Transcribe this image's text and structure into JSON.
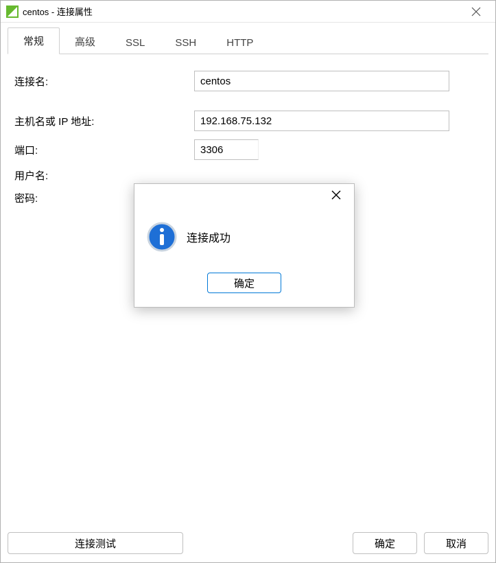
{
  "titlebar": {
    "title": "centos - 连接属性"
  },
  "tabs": {
    "general": "常规",
    "advanced": "高级",
    "ssl": "SSL",
    "ssh": "SSH",
    "http": "HTTP"
  },
  "form": {
    "connection_name_label": "连接名:",
    "connection_name_value": "centos",
    "host_label": "主机名或 IP 地址:",
    "host_value": "192.168.75.132",
    "port_label": "端口:",
    "port_value": "3306",
    "username_label": "用户名:",
    "password_label": "密码:"
  },
  "buttons": {
    "test_connection": "连接测试",
    "ok": "确定",
    "cancel": "取消"
  },
  "dialog": {
    "message": "连接成功",
    "ok": "确定"
  }
}
